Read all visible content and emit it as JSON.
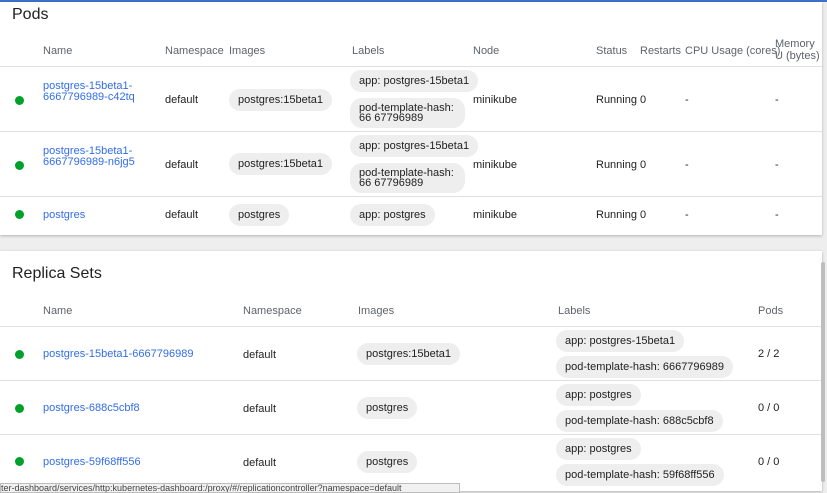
{
  "pods": {
    "title": "Pods",
    "headers": {
      "name": "Name",
      "namespace": "Namespace",
      "images": "Images",
      "labels": "Labels",
      "node": "Node",
      "status": "Status",
      "restarts": "Restarts",
      "cpu": "CPU Usage (cores)",
      "memory": "Memory U (bytes)"
    },
    "rows": [
      {
        "name": "postgres-15beta1-6667796989-c42tq",
        "namespace": "default",
        "image": "postgres:15beta1",
        "labels": [
          "app: postgres-15beta1",
          "pod-template-hash: 66 67796989"
        ],
        "node": "minikube",
        "status": "Running",
        "restarts": "0",
        "cpu": "-",
        "memory": "-"
      },
      {
        "name": "postgres-15beta1-6667796989-n6jg5",
        "namespace": "default",
        "image": "postgres:15beta1",
        "labels": [
          "app: postgres-15beta1",
          "pod-template-hash: 66 67796989"
        ],
        "node": "minikube",
        "status": "Running",
        "restarts": "0",
        "cpu": "-",
        "memory": "-"
      },
      {
        "name": "postgres",
        "namespace": "default",
        "image": "postgres",
        "labels": [
          "app: postgres"
        ],
        "node": "minikube",
        "status": "Running",
        "restarts": "0",
        "cpu": "-",
        "memory": "-"
      }
    ]
  },
  "replica_sets": {
    "title": "Replica Sets",
    "headers": {
      "name": "Name",
      "namespace": "Namespace",
      "images": "Images",
      "labels": "Labels",
      "pods": "Pods"
    },
    "rows": [
      {
        "name": "postgres-15beta1-6667796989",
        "namespace": "default",
        "image": "postgres:15beta1",
        "labels": [
          "app: postgres-15beta1",
          "pod-template-hash: 6667796989"
        ],
        "pods": "2 / 2"
      },
      {
        "name": "postgres-688c5cbf8",
        "namespace": "default",
        "image": "postgres",
        "labels": [
          "app: postgres",
          "pod-template-hash: 688c5cbf8"
        ],
        "pods": "0 / 0"
      },
      {
        "name": "postgres-59f68ff556",
        "namespace": "default",
        "image": "postgres",
        "labels": [
          "app: postgres",
          "pod-template-hash: 59f68ff556"
        ],
        "pods": "0 / 0"
      }
    ]
  },
  "status_bar": {
    "text": "ter-dashboard/services/http:kubernetes-dashboard:/proxy/#/replicationcontroller?namespace=default"
  },
  "colors": {
    "running_dot": "#00a12b",
    "link": "#326de6",
    "accent": "#3f72c9"
  }
}
